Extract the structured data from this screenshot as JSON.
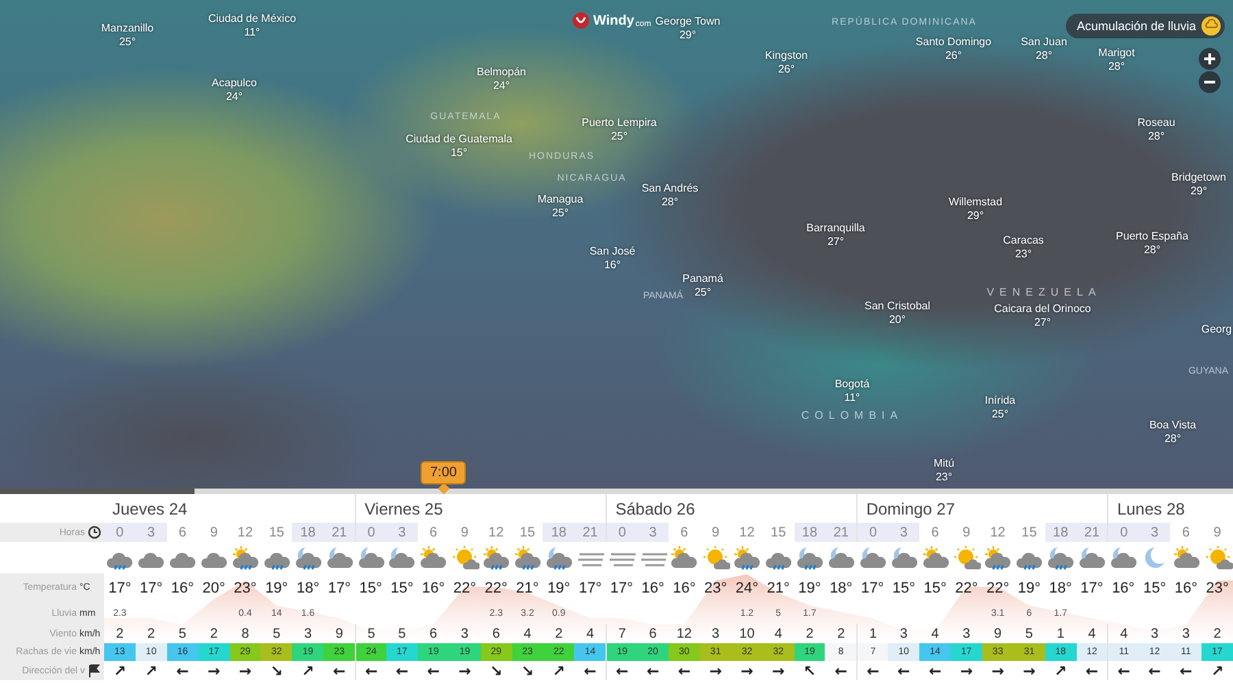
{
  "map": {
    "logo": {
      "name": "Windy",
      "suffix": "com"
    },
    "layer_button": {
      "label": "Acumulación de lluvia"
    },
    "cities": [
      {
        "name": "Ciudad de México",
        "temp": "11°"
      },
      {
        "name": "George Town",
        "temp": "29°"
      },
      {
        "name": "Manzanillo",
        "temp": "25°"
      },
      {
        "name": "Kingston",
        "temp": "26°"
      },
      {
        "name": "Santo Domingo",
        "temp": "26°"
      },
      {
        "name": "San Juan",
        "temp": "28°"
      },
      {
        "name": "Marigot",
        "temp": "28°"
      },
      {
        "name": "Belmopán",
        "temp": "24°"
      },
      {
        "name": "Acapulco",
        "temp": "24°"
      },
      {
        "name": "Puerto Lempira",
        "temp": "25°"
      },
      {
        "name": "Roseau",
        "temp": "28°"
      },
      {
        "name": "Ciudad de Guatemala",
        "temp": "15°"
      },
      {
        "name": "Bridgetown",
        "temp": "29°"
      },
      {
        "name": "San Andrés",
        "temp": "28°"
      },
      {
        "name": "Managua",
        "temp": "25°"
      },
      {
        "name": "Willemstad",
        "temp": "29°"
      },
      {
        "name": "Barranquilla",
        "temp": "27°"
      },
      {
        "name": "Caracas",
        "temp": "23°"
      },
      {
        "name": "Puerto España",
        "temp": "28°"
      },
      {
        "name": "San José",
        "temp": "16°"
      },
      {
        "name": "Panamá",
        "temp": "25°"
      },
      {
        "name": "San Cristobal",
        "temp": "20°"
      },
      {
        "name": "Caicara del Orinoco",
        "temp": "27°"
      },
      {
        "name": "Georg"
      },
      {
        "name": "Bogotá",
        "temp": "11°"
      },
      {
        "name": "Inírida",
        "temp": "25°"
      },
      {
        "name": "Boa Vista",
        "temp": "28°"
      },
      {
        "name": "Mitú",
        "temp": "23°"
      }
    ],
    "countries": [
      "REPÚBLICA DOMINICANA",
      "GUATEMALA",
      "HONDURAS",
      "NICARAGUA",
      "PANAMÁ",
      "VENEZUELA",
      "GUYANA",
      "COLOMBIA"
    ]
  },
  "timeline": {
    "time": "7:00"
  },
  "row_labels": [
    {
      "kind": "hours",
      "label": "Horas"
    },
    {
      "kind": "temp",
      "label": "Temperatura",
      "unit": "°C"
    },
    {
      "kind": "rain",
      "label": "Lluvia",
      "unit": "mm"
    },
    {
      "kind": "wind",
      "label": "Viento",
      "unit": "km/h"
    },
    {
      "kind": "gust",
      "label": "Rachas de vie",
      "unit": "km/h"
    },
    {
      "kind": "direction",
      "label": "Dirección del v"
    }
  ],
  "days": [
    {
      "label": "Jueves 24",
      "hours": [
        {
          "hour": "0",
          "kind": "rain",
          "night": true,
          "temp": "17°",
          "rain": "2.3",
          "wind": "2",
          "gust": "13",
          "direction": "↗"
        },
        {
          "hour": "3",
          "kind": "cloud",
          "night": true,
          "temp": "17°",
          "wind": "2",
          "gust": "10",
          "direction": "↗"
        },
        {
          "hour": "6",
          "kind": "cloud",
          "night": false,
          "temp": "16°",
          "wind": "5",
          "gust": "16",
          "direction": "←"
        },
        {
          "hour": "9",
          "kind": "cloud",
          "night": false,
          "temp": "20°",
          "wind": "2",
          "gust": "17",
          "direction": "→"
        },
        {
          "hour": "12",
          "kind": "sun-rain",
          "night": false,
          "temp": "23°",
          "rain": "0.4",
          "wind": "8",
          "gust": "29",
          "direction": "→"
        },
        {
          "hour": "15",
          "kind": "rain",
          "night": false,
          "temp": "19°",
          "rain": "14",
          "wind": "5",
          "gust": "32",
          "direction": "↘"
        },
        {
          "hour": "18",
          "kind": "moon-rain",
          "night": true,
          "temp": "18°",
          "rain": "1.6",
          "wind": "3",
          "gust": "19",
          "direction": "↗"
        },
        {
          "hour": "21",
          "kind": "moon-cloud",
          "night": true,
          "temp": "17°",
          "wind": "9",
          "gust": "23",
          "direction": "←"
        }
      ]
    },
    {
      "label": "Viernes 25",
      "hours": [
        {
          "hour": "0",
          "kind": "moon-cloud",
          "night": true,
          "temp": "15°",
          "wind": "5",
          "gust": "24",
          "direction": "←"
        },
        {
          "hour": "3",
          "kind": "moon-cloud",
          "night": true,
          "temp": "15°",
          "wind": "5",
          "gust": "17",
          "direction": "←"
        },
        {
          "hour": "6",
          "kind": "sun-cloud",
          "night": false,
          "temp": "16°",
          "wind": "6",
          "gust": "19",
          "direction": "←"
        },
        {
          "hour": "9",
          "kind": "sun",
          "night": false,
          "temp": "22°",
          "wind": "3",
          "gust": "19",
          "direction": "→"
        },
        {
          "hour": "12",
          "kind": "sun-rain",
          "night": false,
          "temp": "22°",
          "rain": "2.3",
          "wind": "6",
          "gust": "29",
          "direction": "↘"
        },
        {
          "hour": "15",
          "kind": "sun-rain",
          "night": false,
          "temp": "21°",
          "rain": "3.2",
          "wind": "4",
          "gust": "23",
          "direction": "↘"
        },
        {
          "hour": "18",
          "kind": "moon-rain",
          "night": true,
          "temp": "19°",
          "rain": "0.9",
          "wind": "2",
          "gust": "22",
          "direction": "↗"
        },
        {
          "hour": "21",
          "kind": "fog",
          "night": true,
          "temp": "17°",
          "wind": "4",
          "gust": "14",
          "direction": "←"
        }
      ]
    },
    {
      "label": "Sábado 26",
      "hours": [
        {
          "hour": "0",
          "kind": "fog",
          "night": true,
          "temp": "17°",
          "wind": "7",
          "gust": "19",
          "direction": "←"
        },
        {
          "hour": "3",
          "kind": "fog",
          "night": true,
          "temp": "16°",
          "wind": "6",
          "gust": "20",
          "direction": "←"
        },
        {
          "hour": "6",
          "kind": "sun-cloud",
          "night": false,
          "temp": "16°",
          "wind": "12",
          "gust": "30",
          "direction": "←"
        },
        {
          "hour": "9",
          "kind": "sun",
          "night": false,
          "temp": "23°",
          "wind": "3",
          "gust": "31",
          "direction": "→"
        },
        {
          "hour": "12",
          "kind": "sun-rain",
          "night": false,
          "temp": "24°",
          "rain": "1.2",
          "wind": "10",
          "gust": "32",
          "direction": "→"
        },
        {
          "hour": "15",
          "kind": "rain",
          "night": false,
          "temp": "21°",
          "rain": "5",
          "wind": "4",
          "gust": "32",
          "direction": "→"
        },
        {
          "hour": "18",
          "kind": "moon-rain",
          "night": true,
          "temp": "19°",
          "rain": "1.7",
          "wind": "2",
          "gust": "19",
          "direction": "↖"
        },
        {
          "hour": "21",
          "kind": "moon-cloud",
          "night": true,
          "temp": "18°",
          "wind": "2",
          "gust": "8",
          "direction": "←"
        }
      ]
    },
    {
      "label": "Domingo 27",
      "hours": [
        {
          "hour": "0",
          "kind": "moon-cloud",
          "night": true,
          "temp": "17°",
          "wind": "1",
          "gust": "7",
          "direction": "←"
        },
        {
          "hour": "3",
          "kind": "moon-cloud",
          "night": true,
          "temp": "15°",
          "wind": "3",
          "gust": "10",
          "direction": "←"
        },
        {
          "hour": "6",
          "kind": "sun-cloud",
          "night": false,
          "temp": "15°",
          "wind": "4",
          "gust": "14",
          "direction": "←"
        },
        {
          "hour": "9",
          "kind": "sun",
          "night": false,
          "temp": "22°",
          "wind": "3",
          "gust": "17",
          "direction": "→"
        },
        {
          "hour": "12",
          "kind": "sun-rain",
          "night": false,
          "temp": "22°",
          "rain": "3.1",
          "wind": "9",
          "gust": "33",
          "direction": "→"
        },
        {
          "hour": "15",
          "kind": "rain",
          "night": false,
          "temp": "19°",
          "rain": "6",
          "wind": "5",
          "gust": "31",
          "direction": "→"
        },
        {
          "hour": "18",
          "kind": "moon-rain",
          "night": true,
          "temp": "18°",
          "rain": "1.7",
          "wind": "1",
          "gust": "18",
          "direction": "↗"
        },
        {
          "hour": "21",
          "kind": "moon-cloud",
          "night": true,
          "temp": "17°",
          "wind": "4",
          "gust": "12",
          "direction": "←"
        }
      ]
    },
    {
      "label": "Lunes 28",
      "hours": [
        {
          "hour": "0",
          "kind": "moon-cloud",
          "night": true,
          "temp": "16°",
          "wind": "4",
          "gust": "11",
          "direction": "←"
        },
        {
          "hour": "3",
          "kind": "moon",
          "night": true,
          "temp": "15°",
          "wind": "3",
          "gust": "12",
          "direction": "←"
        },
        {
          "hour": "6",
          "kind": "sun-cloud",
          "night": false,
          "temp": "16°",
          "wind": "3",
          "gust": "11",
          "direction": "←"
        },
        {
          "hour": "9",
          "kind": "sun",
          "night": false,
          "temp": "23°",
          "wind": "2",
          "gust": "17",
          "direction": "↗"
        }
      ]
    }
  ]
}
